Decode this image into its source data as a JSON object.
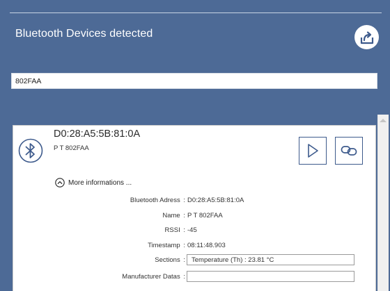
{
  "header": {
    "title": "Bluetooth Devices detected",
    "action_icon": "export-icon"
  },
  "search": {
    "value": "802FAA"
  },
  "device": {
    "address": "D0:28:A5:5B:81:0A",
    "name": "P T 802FAA",
    "icon": "bluetooth-icon",
    "actions": [
      {
        "name": "play-button",
        "icon": "play-icon"
      },
      {
        "name": "connect-button",
        "icon": "link-icon"
      }
    ],
    "more_info_label": "More informations ...",
    "details": {
      "bluetooth_address": {
        "label": "Bluetooth Adress",
        "value": "D0:28:A5:5B:81:0A"
      },
      "name": {
        "label": "Name",
        "value": "P T 802FAA"
      },
      "rssi": {
        "label": "RSSI",
        "value": "-45"
      },
      "timestamp": {
        "label": "Timestamp",
        "value": "08:11:48.903"
      },
      "sections": {
        "label": "Sections",
        "value": "Temperature (Th) : 23.81 °C"
      },
      "manufacturer_datas": {
        "label": "Manufacturer Datas",
        "value": ""
      }
    }
  },
  "colors": {
    "header_bg": "#4d6a96",
    "accent": "#3d5a8c",
    "card_bg": "#ffffff"
  }
}
